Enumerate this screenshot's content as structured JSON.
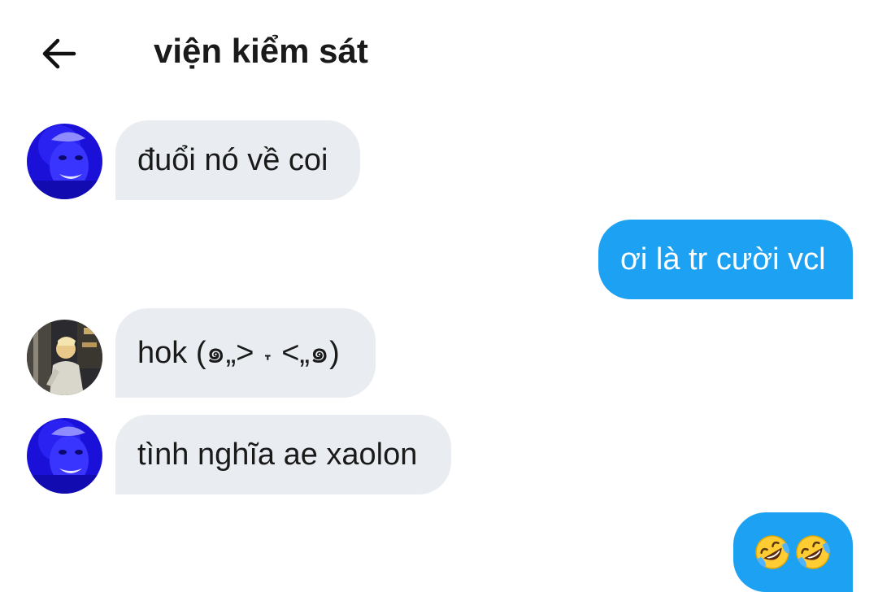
{
  "header": {
    "title": "viện kiểm sát",
    "back_icon": "arrow-left-icon"
  },
  "messages": [
    {
      "direction": "incoming",
      "text": "đuổi nó về coi",
      "avatar": "avatar-blue-portrait"
    },
    {
      "direction": "outgoing",
      "text": "ơi là tr cười vcl"
    },
    {
      "direction": "incoming",
      "text": "hok (๑„> ˕ <„๑)",
      "avatar": "avatar-street-photo"
    },
    {
      "direction": "incoming",
      "text": "tình nghĩa ae xaolon",
      "avatar": "avatar-blue-portrait"
    },
    {
      "direction": "outgoing",
      "text": "🤣🤣",
      "emoji": [
        "rolling-on-floor-laughing-icon",
        "rolling-on-floor-laughing-icon"
      ]
    }
  ],
  "colors": {
    "incoming_bubble": "#e9edf1",
    "outgoing_bubble": "#1da1f2",
    "outgoing_text": "#ffffff",
    "incoming_text": "#1a1a1a"
  }
}
